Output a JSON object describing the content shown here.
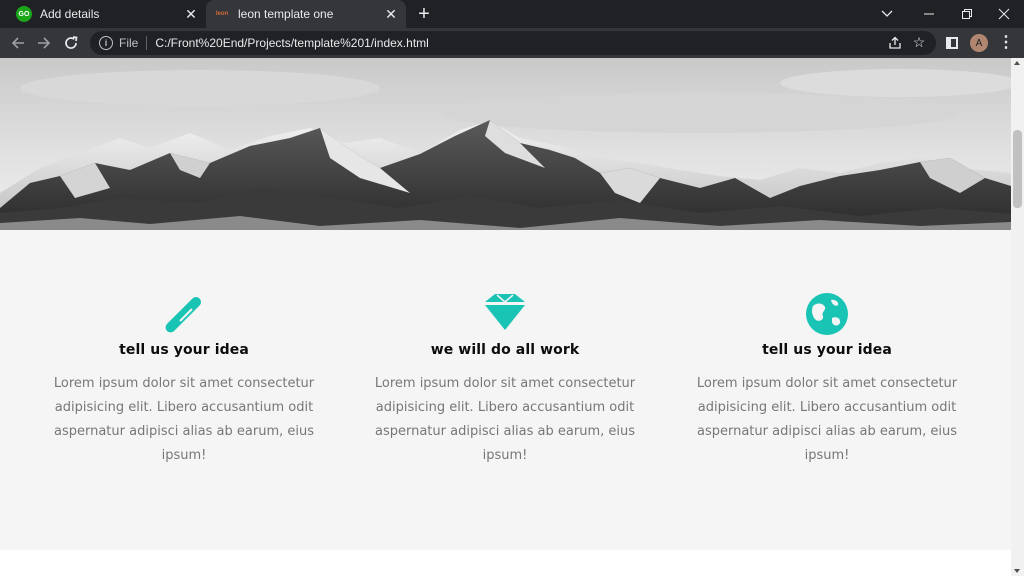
{
  "browser": {
    "tabs": [
      {
        "title": "Add details",
        "favicon_text": "GO",
        "active": false
      },
      {
        "title": "leon template one",
        "favicon_text": "leon",
        "active": true
      }
    ],
    "new_tab_icon": "plus-icon",
    "address": {
      "scheme_label": "File",
      "url": "C:/Front%20End/Projects/template%201/index.html"
    },
    "profile_initial": "A"
  },
  "page": {
    "hero_image": "mountain-range-grayscale",
    "features": [
      {
        "icon": "pencil-icon",
        "title": "tell us your idea",
        "text": "Lorem ipsum dolor sit amet consectetur adipisicing elit. Libero accusantium odit aspernatur adipisci alias ab earum, eius ipsum!"
      },
      {
        "icon": "diamond-icon",
        "title": "we will do all work",
        "text": "Lorem ipsum dolor sit amet consectetur adipisicing elit. Libero accusantium odit aspernatur adipisci alias ab earum, eius ipsum!"
      },
      {
        "icon": "globe-icon",
        "title": "tell us your idea",
        "text": "Lorem ipsum dolor sit amet consectetur adipisicing elit. Libero accusantium odit aspernatur adipisci alias ab earum, eius ipsum!"
      }
    ]
  },
  "colors": {
    "accent": "#19c4b4",
    "section_bg": "#f5f5f5",
    "browser_frame": "#202124",
    "toolbar": "#35363a"
  }
}
